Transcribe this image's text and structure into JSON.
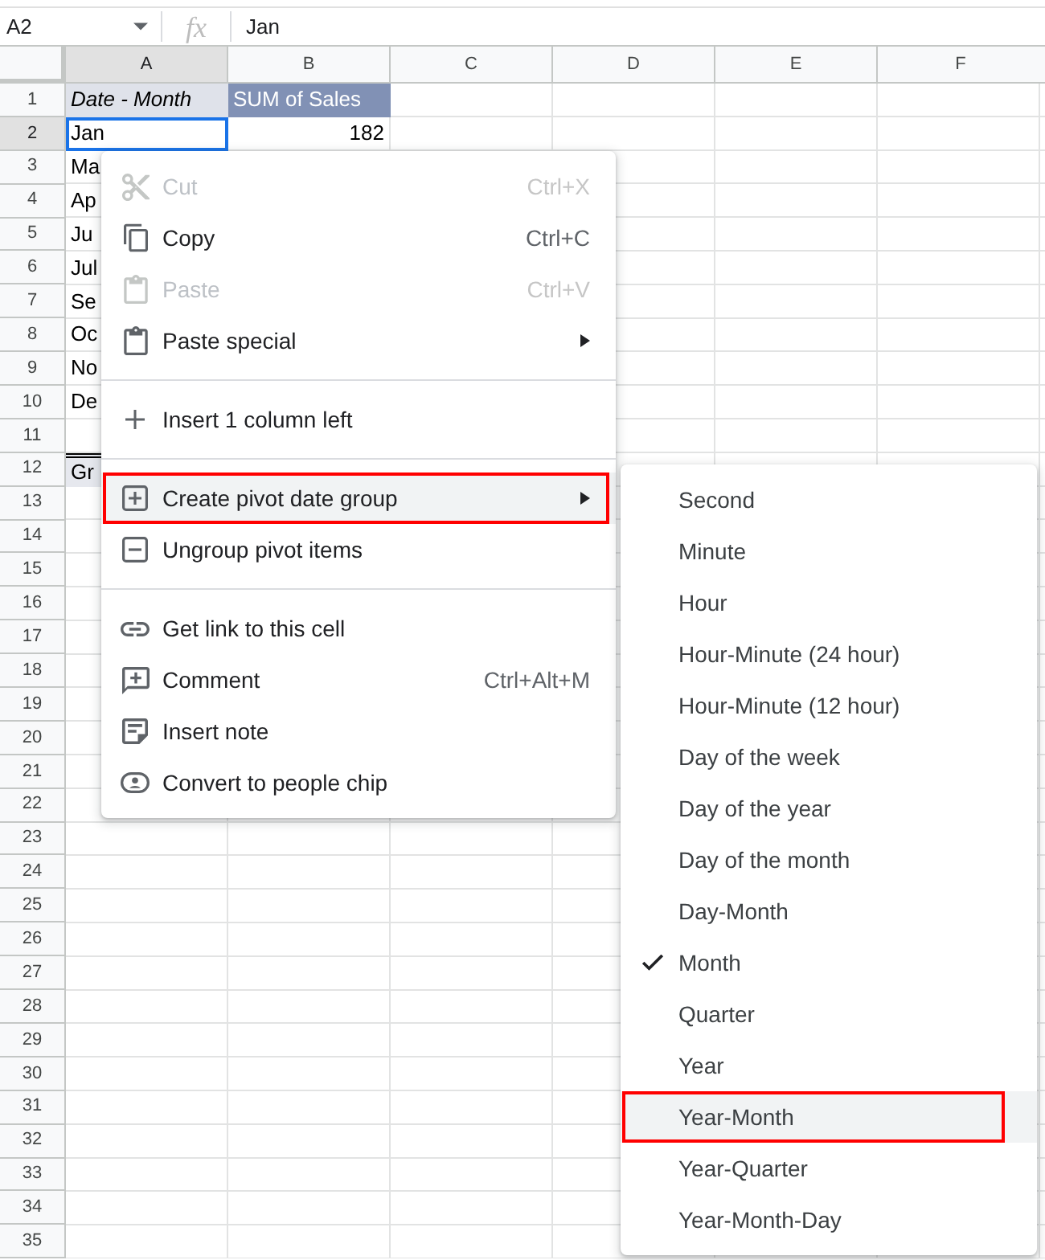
{
  "formula_bar": {
    "cell_reference": "A2",
    "function_label": "fx",
    "value": "Jan"
  },
  "column_headers": [
    {
      "label": "A",
      "selected": true
    },
    {
      "label": "B",
      "selected": false
    },
    {
      "label": "C",
      "selected": false
    },
    {
      "label": "D",
      "selected": false
    },
    {
      "label": "E",
      "selected": false
    },
    {
      "label": "F",
      "selected": false
    }
  ],
  "rows": [
    {
      "number": "1",
      "selected": false,
      "cells": [
        {
          "kind": "pivot_label",
          "text": "Date - Month",
          "selected": false
        },
        {
          "kind": "pivot_value_header",
          "text": "SUM of Sales",
          "selected": false
        }
      ]
    },
    {
      "number": "2",
      "selected": true,
      "cells": [
        {
          "kind": "text",
          "text": "Jan",
          "selected": true
        },
        {
          "kind": "number",
          "text": "182",
          "selected": false
        }
      ]
    },
    {
      "number": "3",
      "selected": false,
      "cells": [
        {
          "kind": "text",
          "text": "Ma",
          "selected": false
        }
      ]
    },
    {
      "number": "4",
      "selected": false,
      "cells": [
        {
          "kind": "text",
          "text": "Ap",
          "selected": false
        }
      ]
    },
    {
      "number": "5",
      "selected": false,
      "cells": [
        {
          "kind": "text",
          "text": "Ju",
          "selected": false
        }
      ]
    },
    {
      "number": "6",
      "selected": false,
      "cells": [
        {
          "kind": "text",
          "text": "Jul",
          "selected": false
        }
      ]
    },
    {
      "number": "7",
      "selected": false,
      "cells": [
        {
          "kind": "text",
          "text": "Se",
          "selected": false
        }
      ]
    },
    {
      "number": "8",
      "selected": false,
      "cells": [
        {
          "kind": "text",
          "text": "Oc",
          "selected": false
        }
      ]
    },
    {
      "number": "9",
      "selected": false,
      "cells": [
        {
          "kind": "text",
          "text": "No",
          "selected": false
        }
      ]
    },
    {
      "number": "10",
      "selected": false,
      "cells": [
        {
          "kind": "text",
          "text": "De",
          "selected": false
        }
      ]
    },
    {
      "number": "11",
      "selected": false
    },
    {
      "number": "12",
      "selected": false,
      "cells": [
        {
          "kind": "total",
          "text": "Gr",
          "selected": false
        }
      ]
    },
    {
      "number": "13",
      "selected": false
    },
    {
      "number": "14",
      "selected": false
    },
    {
      "number": "15",
      "selected": false
    },
    {
      "number": "16",
      "selected": false
    },
    {
      "number": "17",
      "selected": false
    },
    {
      "number": "18",
      "selected": false
    },
    {
      "number": "19",
      "selected": false
    },
    {
      "number": "20",
      "selected": false
    },
    {
      "number": "21",
      "selected": false
    },
    {
      "number": "22",
      "selected": false
    },
    {
      "number": "23",
      "selected": false
    },
    {
      "number": "24",
      "selected": false
    },
    {
      "number": "25",
      "selected": false
    },
    {
      "number": "26",
      "selected": false
    },
    {
      "number": "27",
      "selected": false
    },
    {
      "number": "28",
      "selected": false
    },
    {
      "number": "29",
      "selected": false
    },
    {
      "number": "30",
      "selected": false
    },
    {
      "number": "31",
      "selected": false
    },
    {
      "number": "32",
      "selected": false
    },
    {
      "number": "33",
      "selected": false
    },
    {
      "number": "34",
      "selected": false
    },
    {
      "number": "35",
      "selected": false
    }
  ],
  "context_menu": {
    "items": [
      {
        "kind": "item",
        "label": "Cut",
        "shortcut": "Ctrl+X",
        "disabled": true,
        "submenu": false,
        "hovered": false,
        "annotated": false
      },
      {
        "kind": "item",
        "label": "Copy",
        "shortcut": "Ctrl+C",
        "disabled": false,
        "submenu": false,
        "hovered": false,
        "annotated": false
      },
      {
        "kind": "item",
        "label": "Paste",
        "shortcut": "Ctrl+V",
        "disabled": true,
        "submenu": false,
        "hovered": false,
        "annotated": false
      },
      {
        "kind": "item",
        "label": "Paste special",
        "disabled": false,
        "submenu": true,
        "hovered": false,
        "annotated": false
      },
      {
        "kind": "separator"
      },
      {
        "kind": "item",
        "label": "Insert 1 column left",
        "disabled": false,
        "submenu": false,
        "hovered": false,
        "annotated": false
      },
      {
        "kind": "separator"
      },
      {
        "kind": "item",
        "label": "Create pivot date group",
        "disabled": false,
        "submenu": true,
        "hovered": true,
        "annotated": true
      },
      {
        "kind": "item",
        "label": "Ungroup pivot items",
        "disabled": false,
        "submenu": false,
        "hovered": false,
        "annotated": false
      },
      {
        "kind": "separator"
      },
      {
        "kind": "item",
        "label": "Get link to this cell",
        "disabled": false,
        "submenu": false,
        "hovered": false,
        "annotated": false
      },
      {
        "kind": "item",
        "label": "Comment",
        "shortcut": "Ctrl+Alt+M",
        "disabled": false,
        "submenu": false,
        "hovered": false,
        "annotated": false
      },
      {
        "kind": "item",
        "label": "Insert note",
        "disabled": false,
        "submenu": false,
        "hovered": false,
        "annotated": false
      },
      {
        "kind": "item",
        "label": "Convert to people chip",
        "disabled": false,
        "submenu": false,
        "hovered": false,
        "annotated": false
      }
    ]
  },
  "submenu": {
    "items": [
      {
        "label": "Second",
        "checked": false,
        "hovered": false,
        "annotated": false
      },
      {
        "label": "Minute",
        "checked": false,
        "hovered": false,
        "annotated": false
      },
      {
        "label": "Hour",
        "checked": false,
        "hovered": false,
        "annotated": false
      },
      {
        "label": "Hour-Minute (24 hour)",
        "checked": false,
        "hovered": false,
        "annotated": false
      },
      {
        "label": "Hour-Minute (12 hour)",
        "checked": false,
        "hovered": false,
        "annotated": false
      },
      {
        "label": "Day of the week",
        "checked": false,
        "hovered": false,
        "annotated": false
      },
      {
        "label": "Day of the year",
        "checked": false,
        "hovered": false,
        "annotated": false
      },
      {
        "label": "Day of the month",
        "checked": false,
        "hovered": false,
        "annotated": false
      },
      {
        "label": "Day-Month",
        "checked": false,
        "hovered": false,
        "annotated": false
      },
      {
        "label": "Month",
        "checked": true,
        "hovered": false,
        "annotated": false
      },
      {
        "label": "Quarter",
        "checked": false,
        "hovered": false,
        "annotated": false
      },
      {
        "label": "Year",
        "checked": false,
        "hovered": false,
        "annotated": false
      },
      {
        "label": "Year-Month",
        "checked": false,
        "hovered": true,
        "annotated": true
      },
      {
        "label": "Year-Quarter",
        "checked": false,
        "hovered": false,
        "annotated": false
      },
      {
        "label": "Year-Month-Day",
        "checked": false,
        "hovered": false,
        "annotated": false
      }
    ]
  }
}
